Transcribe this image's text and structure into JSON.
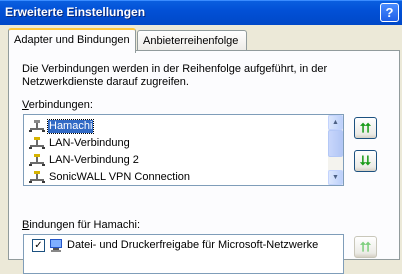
{
  "window": {
    "title": "Erweiterte Einstellungen",
    "help_glyph": "?"
  },
  "tabs": [
    {
      "label": "Adapter und Bindungen",
      "active": true
    },
    {
      "label": "Anbieterreihenfolge",
      "active": false
    }
  ],
  "description": "Die Verbindungen werden in der Reihenfolge aufgeführt, in der Netzwerkdienste darauf zugreifen.",
  "connections": {
    "label_accel": "V",
    "label_rest": "erbindungen:",
    "items": [
      "Hamachi",
      "LAN-Verbindung",
      "LAN-Verbindung 2",
      "SonicWALL VPN Connection"
    ],
    "selected_index": 0
  },
  "bindings": {
    "label_accel": "B",
    "label_rest": "indungen für Hamachi:",
    "items": [
      {
        "label": "Datei- und Druckerfreigabe für Microsoft-Netzwerke",
        "checked": true
      }
    ]
  },
  "icons": {
    "up_arrow": "⮅",
    "down_arrow": "⮇",
    "scroll_up": "▲",
    "scroll_down": "▼",
    "check": "✓"
  },
  "colors": {
    "titlebar": "#0250d6",
    "selection": "#316ac5",
    "arrow_green": "#1a9b1a"
  }
}
